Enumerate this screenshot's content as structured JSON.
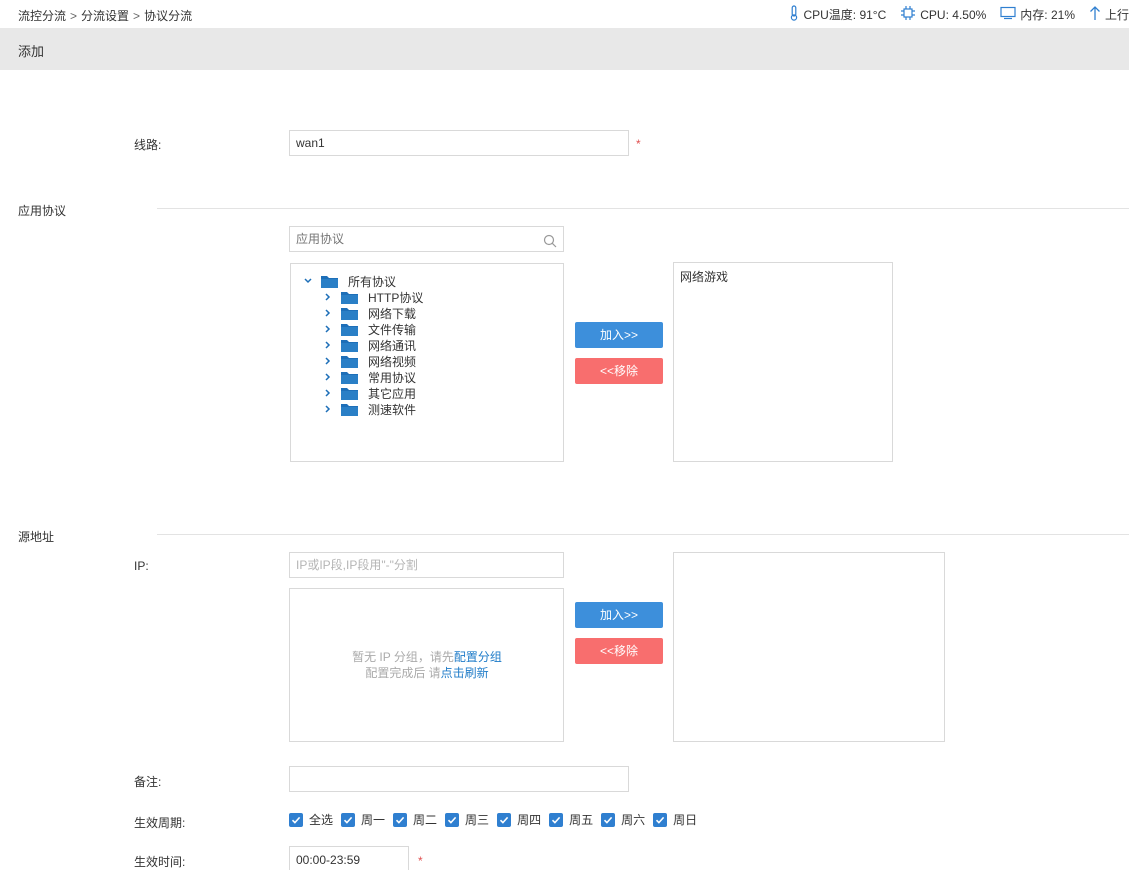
{
  "breadcrumb": [
    "流控分流",
    "分流设置",
    "协议分流"
  ],
  "breadcrumb_sep": ">",
  "stats": {
    "cpu_temp": "CPU温度: 91°C",
    "cpu_usage": "CPU: 4.50%",
    "memory": "内存: 21%",
    "upload": "上行"
  },
  "header": {
    "title": "添加"
  },
  "form": {
    "line_label": "线路:",
    "line_value": "wan1",
    "required_mark": "*",
    "app_section": "应用协议",
    "app_search_placeholder": "应用协议",
    "tree": {
      "root": "所有协议",
      "children": [
        "HTTP协议",
        "网络下载",
        "文件传输",
        "网络通讯",
        "网络视频",
        "常用协议",
        "其它应用",
        "测速软件"
      ]
    },
    "add_label": "加入>>",
    "remove_label": "<<移除",
    "selected_protocols": [
      "网络游戏"
    ],
    "source_section": "源地址",
    "ip_label": "IP:",
    "ip_placeholder": "IP或IP段,IP段用\"-\"分割",
    "empty_line1_prefix": "暂无 IP 分组，请先",
    "empty_line1_link": "配置分组",
    "empty_line2_prefix": "配置完成后 请",
    "empty_line2_link": "点击刷新",
    "remark_label": "备注:",
    "remark_value": "",
    "period_label": "生效周期:",
    "days": [
      "全选",
      "周一",
      "周二",
      "周三",
      "周四",
      "周五",
      "周六",
      "周日"
    ],
    "time_label": "生效时间:",
    "time_value": "00:00-23:59"
  },
  "colors": {
    "primary": "#3d8fdb",
    "danger": "#f86e6e",
    "folder": "#1e6fb8",
    "checkbox": "#2f7fd0",
    "header_bg": "#e8e8e8"
  }
}
